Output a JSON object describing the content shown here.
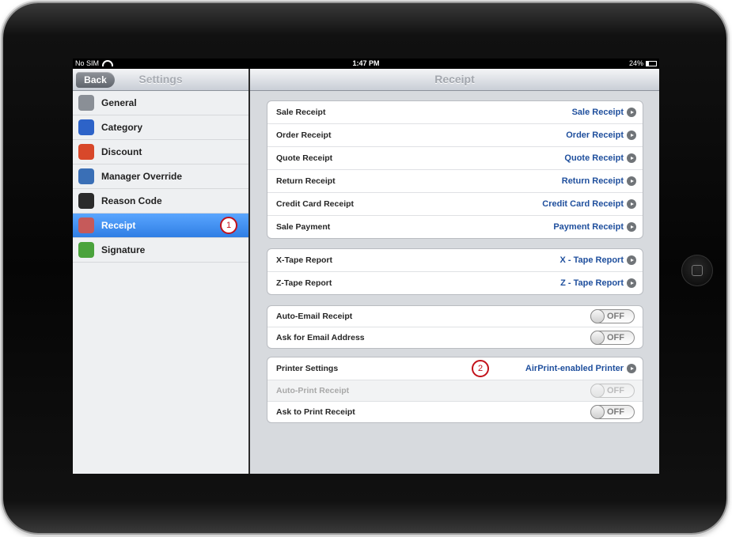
{
  "status_bar": {
    "carrier": "No SIM",
    "time": "1:47 PM",
    "battery": "24%",
    "battery_level": 0.24
  },
  "master": {
    "back_label": "Back",
    "title": "Settings",
    "items": [
      {
        "label": "General",
        "icon": "gear-icon",
        "color": "#8a8f96"
      },
      {
        "label": "Category",
        "icon": "list-icon",
        "color": "#2d63c8"
      },
      {
        "label": "Discount",
        "icon": "tag-icon",
        "color": "#d8482a"
      },
      {
        "label": "Manager Override",
        "icon": "id-card-icon",
        "color": "#3a6fb6"
      },
      {
        "label": "Reason Code",
        "icon": "reason-icon",
        "color": "#2b2b2b"
      },
      {
        "label": "Receipt",
        "icon": "receipt-icon",
        "color": "#c65a5a",
        "selected": true
      },
      {
        "label": "Signature",
        "icon": "pen-icon",
        "color": "#4aa33c"
      }
    ],
    "callout": "1"
  },
  "detail": {
    "title": "Receipt",
    "receipts": [
      {
        "label": "Sale Receipt",
        "value": "Sale Receipt"
      },
      {
        "label": "Order Receipt",
        "value": "Order Receipt"
      },
      {
        "label": "Quote Receipt",
        "value": "Quote Receipt"
      },
      {
        "label": "Return Receipt",
        "value": "Return Receipt"
      },
      {
        "label": "Credit Card Receipt",
        "value": "Credit Card Receipt"
      },
      {
        "label": "Sale Payment",
        "value": "Payment Receipt"
      }
    ],
    "reports": [
      {
        "label": "X-Tape Report",
        "value": "X - Tape Report"
      },
      {
        "label": "Z-Tape Report",
        "value": "Z - Tape Report"
      }
    ],
    "email": [
      {
        "label": "Auto-Email Receipt",
        "toggle": "OFF"
      },
      {
        "label": "Ask for Email Address",
        "toggle": "OFF"
      }
    ],
    "printer": {
      "settings_label": "Printer Settings",
      "settings_value": "AirPrint-enabled Printer",
      "callout": "2",
      "auto_print_label": "Auto-Print Receipt",
      "auto_print_toggle": "OFF",
      "ask_print_label": "Ask to Print Receipt",
      "ask_print_toggle": "OFF"
    }
  }
}
